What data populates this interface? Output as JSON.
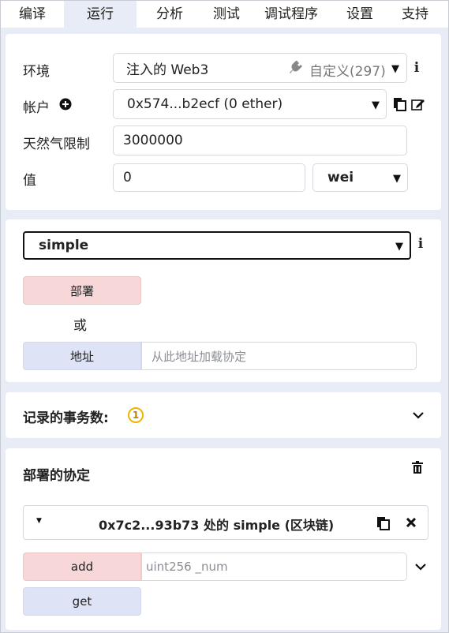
{
  "tabs": [
    {
      "label": "编译",
      "active": false
    },
    {
      "label": "运行",
      "active": true
    },
    {
      "label": "分析",
      "active": false
    },
    {
      "label": "测试",
      "active": false
    },
    {
      "label": "调试程序",
      "active": false
    },
    {
      "label": "设置",
      "active": false
    },
    {
      "label": "支持",
      "active": false
    }
  ],
  "env": {
    "env_label": "环境",
    "env_value": "注入的 Web3",
    "env_network": "自定义(297)",
    "account_label": "帐户",
    "account_value": "0x574...b2ecf (0 ether)",
    "gas_label": "天然气限制",
    "gas_value": "3000000",
    "value_label": "值",
    "value_amount": "0",
    "value_unit": "wei"
  },
  "deploy": {
    "contract_select": "simple",
    "deploy_button": "部署",
    "or_text": "或",
    "at_address_button": "地址",
    "address_placeholder": "从此地址加载协定"
  },
  "transactions": {
    "title": "记录的事务数:",
    "count": "1"
  },
  "deployed": {
    "title": "部署的协定",
    "instance_title": "0x7c2...93b73 处的 simple (区块链)",
    "add_button": "add",
    "add_placeholder": "uint256 _num",
    "get_button": "get"
  },
  "colors": {
    "background": "#e8ecf6",
    "deploy_red": "#f8d7d8",
    "call_blue": "#dfe3f6",
    "badge_yellow": "#f0b400"
  }
}
